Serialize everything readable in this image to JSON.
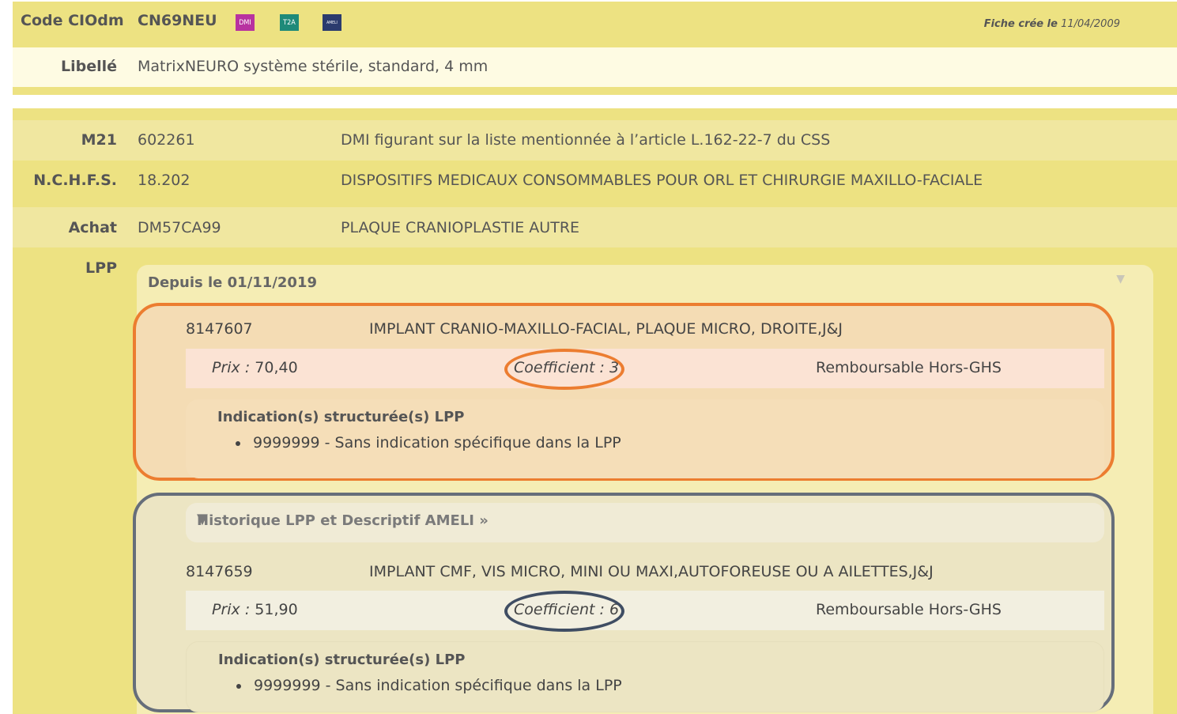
{
  "header": {
    "code_label": "Code CIOdm",
    "code_value": "CN69NEU",
    "badges": [
      {
        "text": "DMI",
        "color": "#b832a0"
      },
      {
        "text": "T2A",
        "color": "#1e8a79"
      },
      {
        "text": "AMELI",
        "color": "#2b3b6e"
      }
    ],
    "fiche_prefix": "Fiche crée le",
    "fiche_date": "11/04/2009"
  },
  "libelle": {
    "label": "Libellé",
    "value": "MatrixNEURO système stérile, standard, 4 mm"
  },
  "m21": {
    "label": "M21",
    "code": "602261",
    "text": "DMI figurant sur la liste mentionnée à l’article L.162-22-7 du CSS"
  },
  "nchfs": {
    "label": "N.C.H.F.S.",
    "code": "18.202",
    "text": "DISPOSITIFS MEDICAUX CONSOMMABLES POUR ORL ET CHIRURGIE MAXILLO-FACIALE"
  },
  "achat": {
    "label": "Achat",
    "code": "DM57CA99",
    "text": "PLAQUE CRANIOPLASTIE AUTRE"
  },
  "lpp": {
    "label": "LPP",
    "panel_title": "Depuis le 01/11/2019",
    "item1": {
      "code": "8147607",
      "desc": "IMPLANT CRANIO-MAXILLO-FACIAL, PLAQUE MICRO, DROITE,J&J",
      "prix_label": "Prix :",
      "prix": "70,40",
      "coef_label": "Coefficient :",
      "coef": "3",
      "remb": "Remboursable Hors-GHS",
      "ind_title": "Indication(s) structurée(s) LPP",
      "ind_item": "9999999 - Sans indication spécifique dans la LPP"
    },
    "history_link": "Historique LPP et Descriptif AMELI »",
    "item2": {
      "code": "8147659",
      "desc": "IMPLANT CMF, VIS MICRO, MINI OU MAXI,AUTOFOREUSE OU A AILETTES,J&J",
      "prix_label": "Prix :",
      "prix": "51,90",
      "coef_label": "Coefficient :",
      "coef": "6",
      "remb": "Remboursable Hors-GHS",
      "ind_title": "Indication(s) structurée(s) LPP",
      "ind_item": "9999999 - Sans indication spécifique dans la LPP"
    }
  }
}
